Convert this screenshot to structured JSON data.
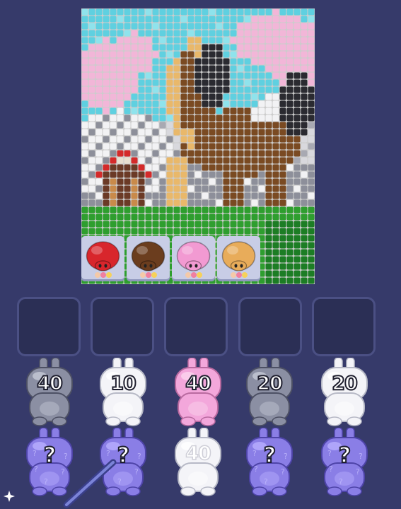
{
  "palette": {
    "background": "#363a6a",
    "sky": "#5fd0e0",
    "blossom": "#f2b6d8",
    "snow": "#f2f2f4",
    "grass": "#2e9e2e",
    "dark_grass": "#1c7d24",
    "horse_brown": "#7a4a22",
    "horse_tan": "#e9b86a",
    "horse_black": "#2a2a30",
    "roof_red": "#d42a2a",
    "gray": "#8d8f9a"
  },
  "collectors": [
    {
      "color": "red",
      "hex": "#d8262c"
    },
    {
      "color": "brown",
      "hex": "#6b3d1e"
    },
    {
      "color": "pink",
      "hex": "#f29ad2"
    },
    {
      "color": "tan",
      "hex": "#e8ac5a"
    }
  ],
  "queue_slots": [
    {
      "state": "empty"
    },
    {
      "state": "empty"
    },
    {
      "state": "empty"
    },
    {
      "state": "empty"
    },
    {
      "state": "empty"
    }
  ],
  "bunnies_front": [
    {
      "color": "gray",
      "count": "40"
    },
    {
      "color": "white",
      "count": "10"
    },
    {
      "color": "pink",
      "count": "40"
    },
    {
      "color": "gray",
      "count": "20"
    },
    {
      "color": "white",
      "count": "20"
    }
  ],
  "bunnies_back": [
    {
      "kind": "mystery",
      "label": "?"
    },
    {
      "kind": "mystery",
      "label": "?"
    },
    {
      "kind": "white",
      "label": "40"
    },
    {
      "kind": "mystery",
      "label": "?"
    },
    {
      "kind": "mystery",
      "label": "?"
    }
  ],
  "icons": {
    "wand": "magic-wand-icon",
    "corner": "sparkle-icon"
  }
}
